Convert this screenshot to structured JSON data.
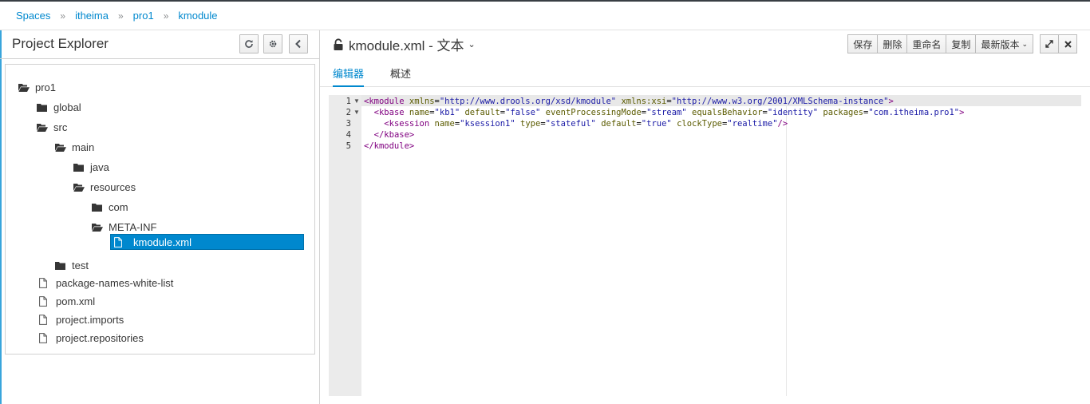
{
  "breadcrumb": [
    "Spaces",
    "itheima",
    "pro1",
    "kmodule"
  ],
  "explorer": {
    "title": "Project Explorer",
    "tree": [
      {
        "label": "pro1",
        "type": "folder-open",
        "depth": 0
      },
      {
        "label": "global",
        "type": "folder",
        "depth": 1
      },
      {
        "label": "src",
        "type": "folder-open",
        "depth": 1
      },
      {
        "label": "main",
        "type": "folder-open",
        "depth": 2
      },
      {
        "label": "java",
        "type": "folder",
        "depth": 3
      },
      {
        "label": "resources",
        "type": "folder-open",
        "depth": 3
      },
      {
        "label": "com",
        "type": "folder",
        "depth": 4
      },
      {
        "label": "META-INF",
        "type": "folder-open",
        "depth": 4
      },
      {
        "label": "kmodule.xml",
        "type": "file",
        "depth": 5,
        "selected": true
      },
      {
        "label": "test",
        "type": "folder",
        "depth": 2
      },
      {
        "label": "package-names-white-list",
        "type": "file",
        "depth": 1
      },
      {
        "label": "pom.xml",
        "type": "file",
        "depth": 1
      },
      {
        "label": "project.imports",
        "type": "file",
        "depth": 1
      },
      {
        "label": "project.repositories",
        "type": "file",
        "depth": 1
      }
    ]
  },
  "editor": {
    "title": "kmodule.xml - 文本",
    "toolbar": {
      "save": "保存",
      "delete": "删除",
      "rename": "重命名",
      "copy": "复制",
      "latest_version": "最新版本"
    },
    "tabs": [
      {
        "label": "编辑器",
        "active": true
      },
      {
        "label": "概述",
        "active": false
      }
    ],
    "lines": [
      {
        "num": "1",
        "fold": true,
        "text": "<kmodule xmlns=\"http://www.drools.org/xsd/kmodule\" xmlns:xsi=\"http://www.w3.org/2001/XMLSchema-instance\">"
      },
      {
        "num": "2",
        "fold": true,
        "text": "  <kbase name=\"kb1\" default=\"false\" eventProcessingMode=\"stream\" equalsBehavior=\"identity\" packages=\"com.itheima.pro1\">"
      },
      {
        "num": "3",
        "fold": false,
        "text": "    <ksession name=\"ksession1\" type=\"stateful\" default=\"true\" clockType=\"realtime\"/>"
      },
      {
        "num": "4",
        "fold": false,
        "text": "  </kbase>"
      },
      {
        "num": "5",
        "fold": false,
        "text": "</kmodule>"
      }
    ]
  },
  "colors": {
    "accent": "#0088ce",
    "tag": "#800080",
    "attribute": "#5b5b00",
    "value": "#1a1aa6"
  }
}
